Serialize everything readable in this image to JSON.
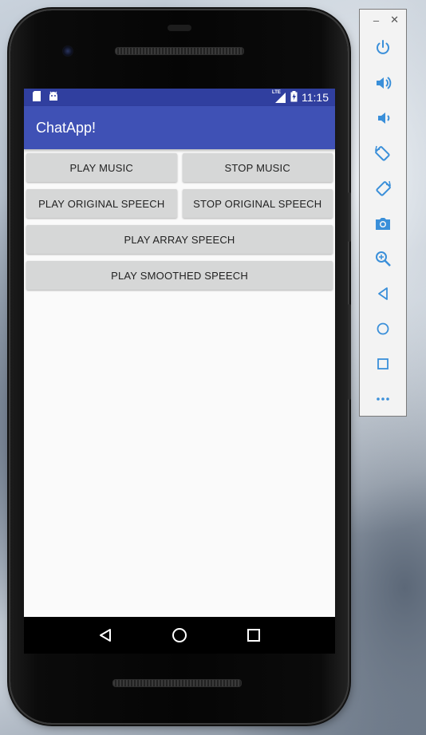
{
  "status_bar": {
    "left_icons": [
      "sd-card-icon",
      "android-icon"
    ],
    "network": "LTE",
    "time": "11:15"
  },
  "app_bar": {
    "title": "ChatApp!"
  },
  "buttons": {
    "play_music": "PLAY MUSIC",
    "stop_music": "STOP MUSIC",
    "play_original_speech": "PLAY ORIGINAL SPEECH",
    "stop_original_speech": "STOP ORIGINAL SPEECH",
    "play_array_speech": "PLAY ARRAY SPEECH",
    "play_smoothed_speech": "PLAY SMOOTHED SPEECH"
  },
  "nav_bar": {
    "icons": [
      "back-icon",
      "home-icon",
      "recents-icon"
    ]
  },
  "emulator_toolbar": {
    "window_controls": [
      "minimize-icon",
      "close-icon"
    ],
    "tools": [
      "power-icon",
      "volume-up-icon",
      "volume-down-icon",
      "rotate-left-icon",
      "rotate-right-icon",
      "camera-icon",
      "zoom-icon",
      "back-icon",
      "home-icon",
      "overview-icon",
      "more-icon"
    ]
  },
  "colors": {
    "status_bar": "#303f9f",
    "app_bar": "#3f51b5",
    "button_bg": "#d6d7d7",
    "toolbar_icon": "#3a8fd9"
  }
}
